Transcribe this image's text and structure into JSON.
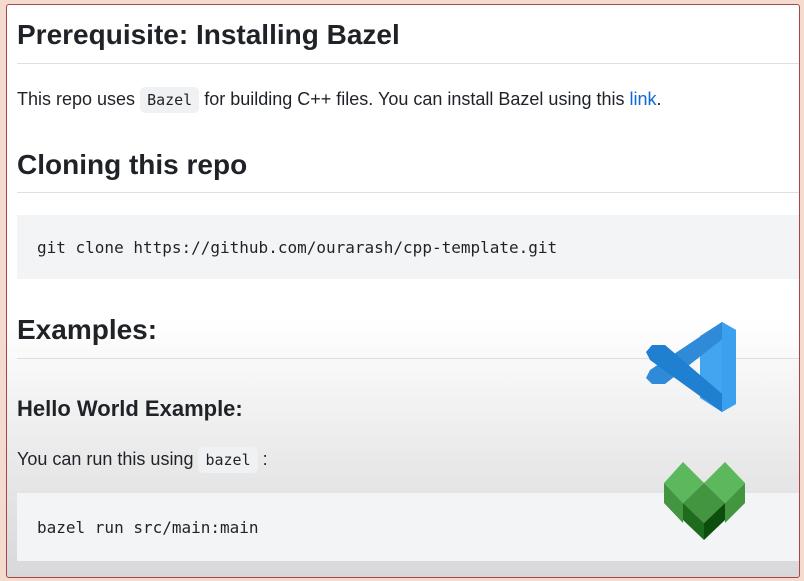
{
  "section1": {
    "title": "Prerequisite: Installing Bazel",
    "text_before": "This repo uses ",
    "code": "Bazel",
    "text_after": " for building C++ files. You can install Bazel using this ",
    "link": "link",
    "end": "."
  },
  "section2": {
    "title": "Cloning this repo",
    "code": "git clone https://github.com/ourarash/cpp-template.git"
  },
  "section3": {
    "title": "Examples:",
    "subtitle": "Hello World Example:",
    "text_before": "You can run this using ",
    "code": "bazel",
    "text_after": " :",
    "command": "bazel run src/main:main"
  },
  "logos": {
    "vscode": "vscode-logo-icon",
    "bazel": "bazel-logo-icon"
  },
  "colors": {
    "link": "#0969da",
    "border": "#a8454a",
    "vscode": "#2b8fe0",
    "bazel": "#43a047"
  }
}
